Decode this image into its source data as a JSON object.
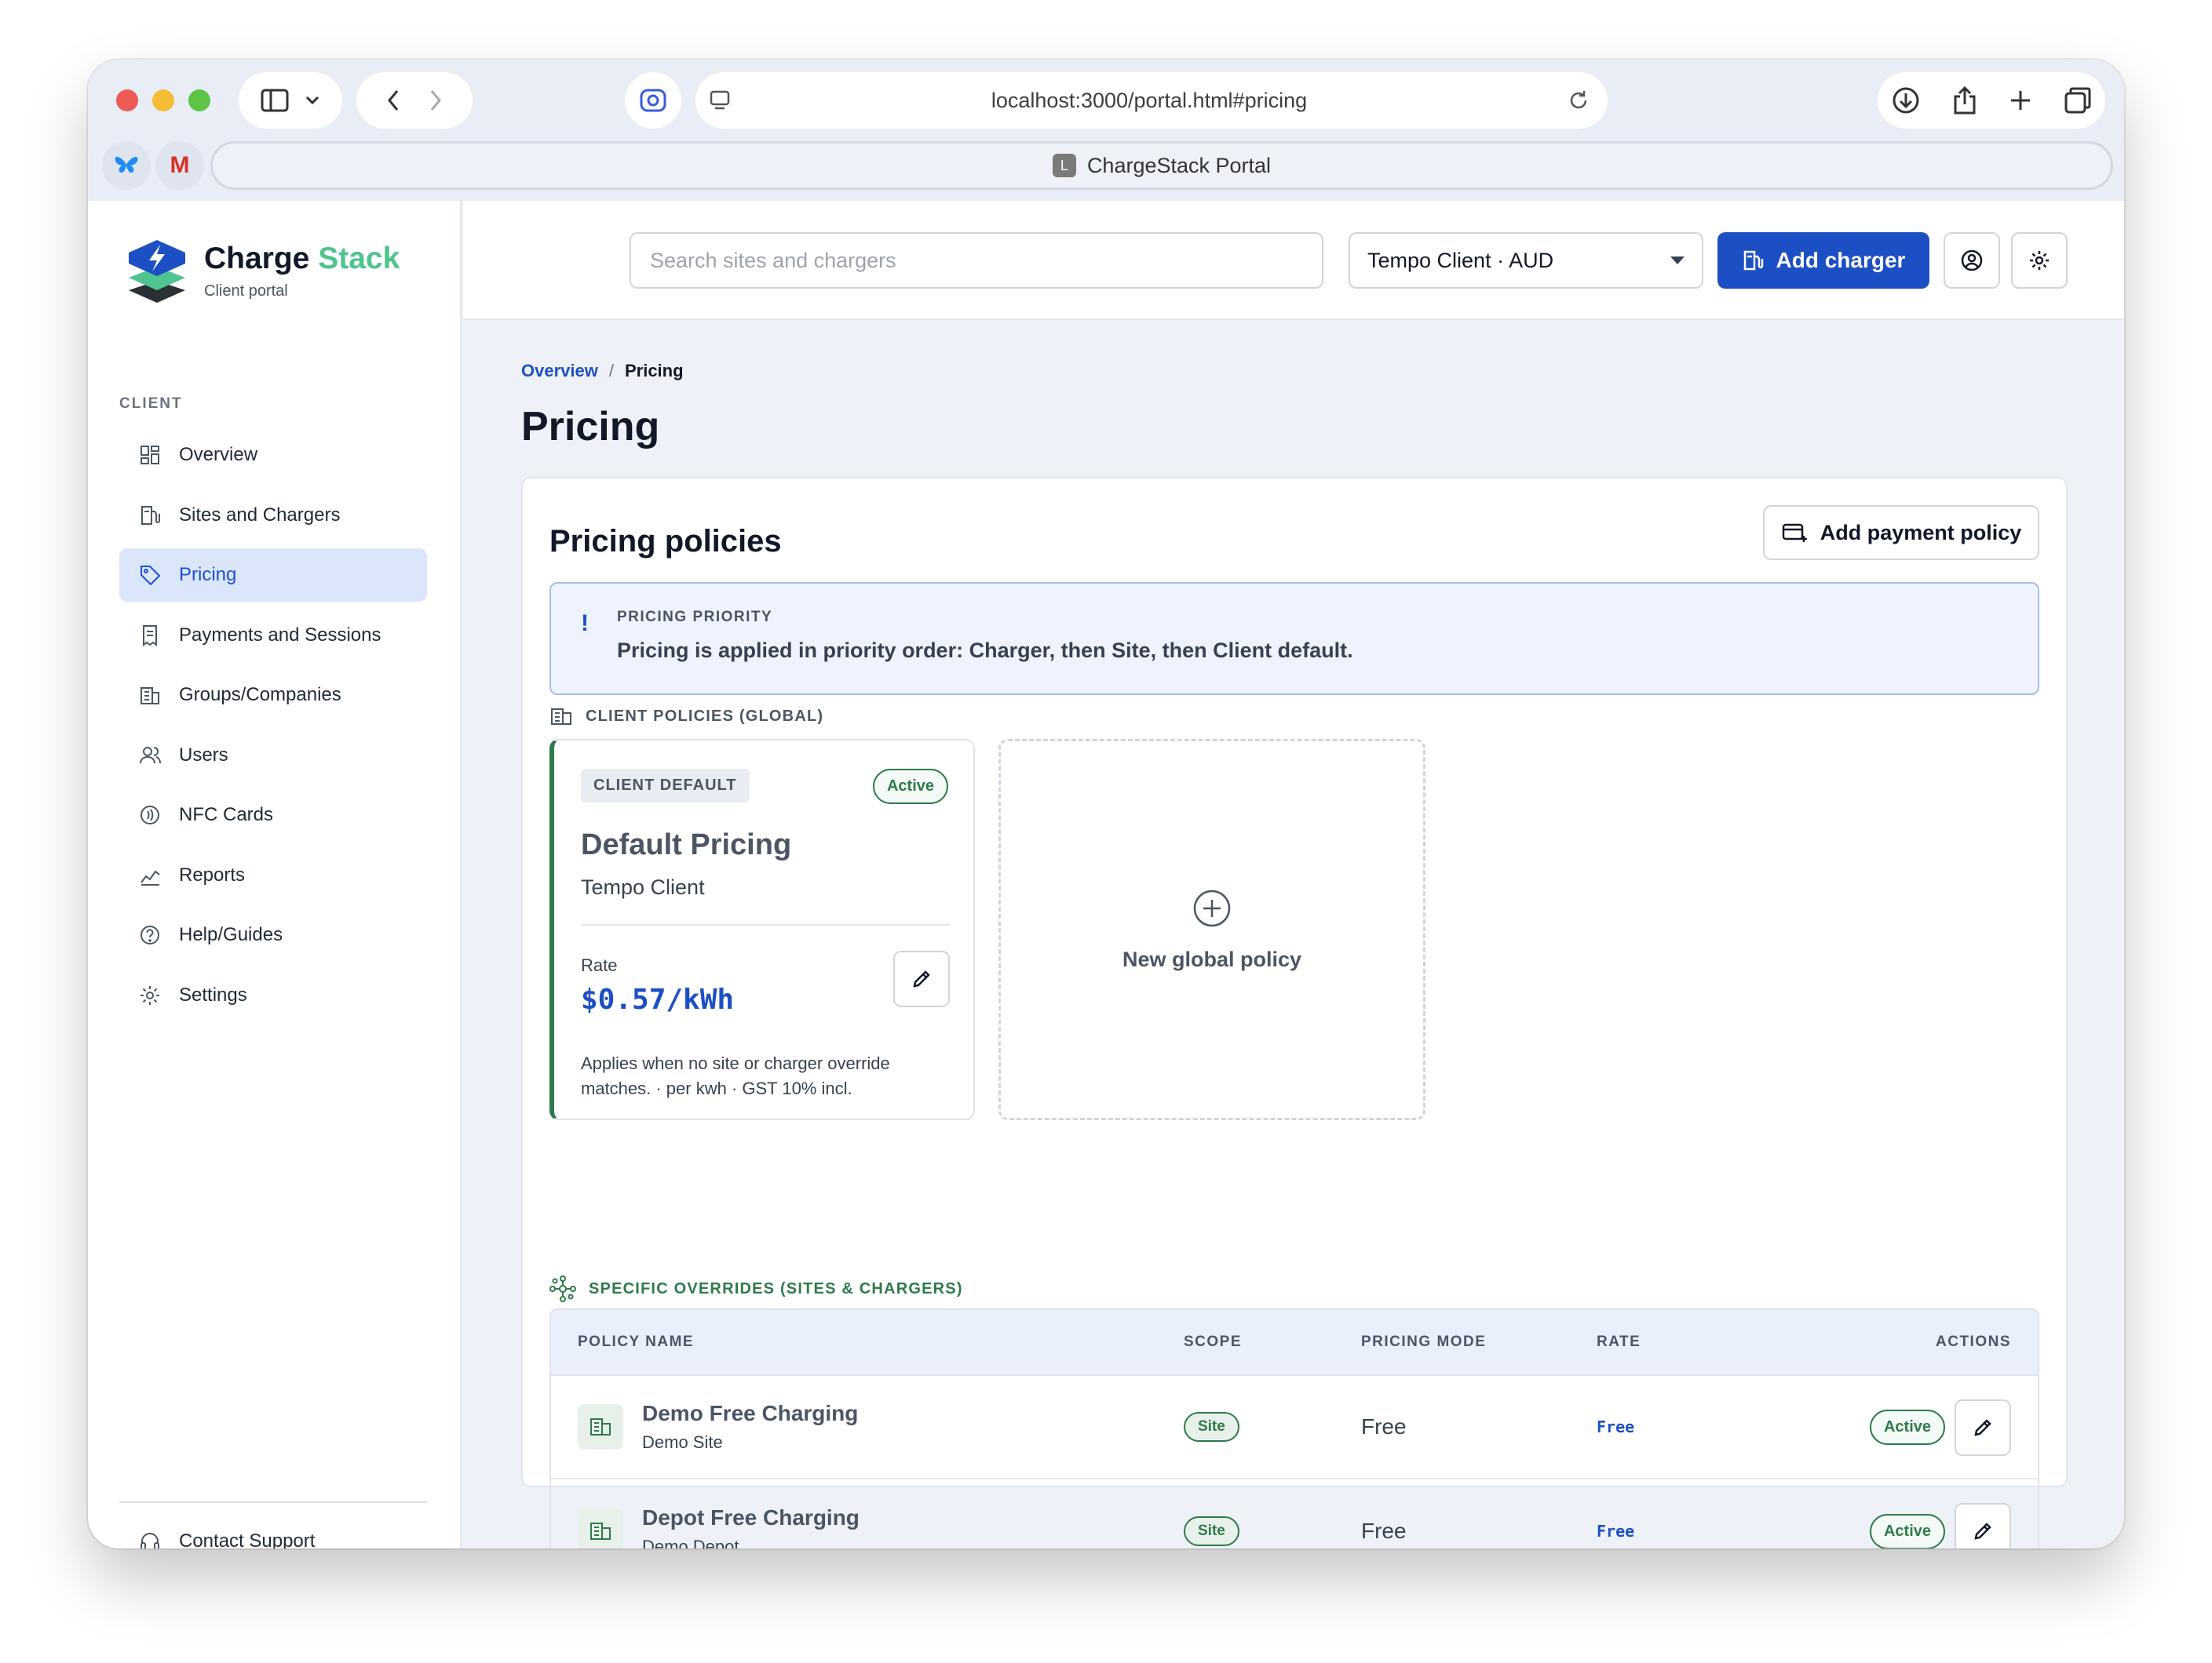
{
  "browser": {
    "url": "localhost:3000/portal.html#pricing",
    "tab_title": "ChargeStack Portal",
    "tab_favicon_letter": "L",
    "extension_gmail": "M"
  },
  "brand": {
    "name_part1": "Charge",
    "name_part2": "Stack",
    "subtitle": "Client portal"
  },
  "sidebar": {
    "section_label": "CLIENT",
    "items": [
      {
        "label": "Overview"
      },
      {
        "label": "Sites and Chargers"
      },
      {
        "label": "Pricing"
      },
      {
        "label": "Payments and Sessions"
      },
      {
        "label": "Groups/Companies"
      },
      {
        "label": "Users"
      },
      {
        "label": "NFC Cards"
      },
      {
        "label": "Reports"
      },
      {
        "label": "Help/Guides"
      },
      {
        "label": "Settings"
      }
    ],
    "active_item": "Pricing",
    "support_label": "Contact Support"
  },
  "topbar": {
    "search_placeholder": "Search sites and chargers",
    "client_select_value": "Tempo Client · AUD",
    "add_charger_label": "Add charger"
  },
  "breadcrumb": {
    "parent": "Overview",
    "separator": "/",
    "current": "Pricing"
  },
  "page_title": "Pricing",
  "policies": {
    "title": "Pricing policies",
    "add_button_label": "Add payment policy",
    "priority": {
      "mark": "!",
      "label": "PRICING PRIORITY",
      "text": "Pricing is applied in priority order: Charger, then Site, then Client default."
    },
    "client_section_label": "CLIENT POLICIES (GLOBAL)",
    "default_card": {
      "tag": "CLIENT DEFAULT",
      "status": "Active",
      "title": "Default Pricing",
      "client": "Tempo Client",
      "rate_label": "Rate",
      "rate": "$0.57/kWh",
      "note": "Applies when no site or charger override matches. · per kwh · GST 10% incl."
    },
    "new_policy_label": "New global policy",
    "specific_section_label": "SPECIFIC OVERRIDES (SITES & CHARGERS)",
    "table": {
      "headers": {
        "name": "POLICY NAME",
        "scope": "SCOPE",
        "mode": "PRICING MODE",
        "rate": "RATE",
        "actions": "ACTIONS"
      },
      "rows": [
        {
          "name": "Demo Free Charging",
          "site": "Demo Site",
          "scope": "Site",
          "mode": "Free",
          "rate": "Free",
          "status": "Active"
        },
        {
          "name": "Depot Free Charging",
          "site": "Demo Depot",
          "scope": "Site",
          "mode": "Free",
          "rate": "Free",
          "status": "Active"
        }
      ]
    }
  },
  "colors": {
    "primary": "#1d4fc4",
    "brand_green": "#4fc48e",
    "success": "#2f7a4a",
    "active_nav_bg": "#dbe6fb"
  }
}
